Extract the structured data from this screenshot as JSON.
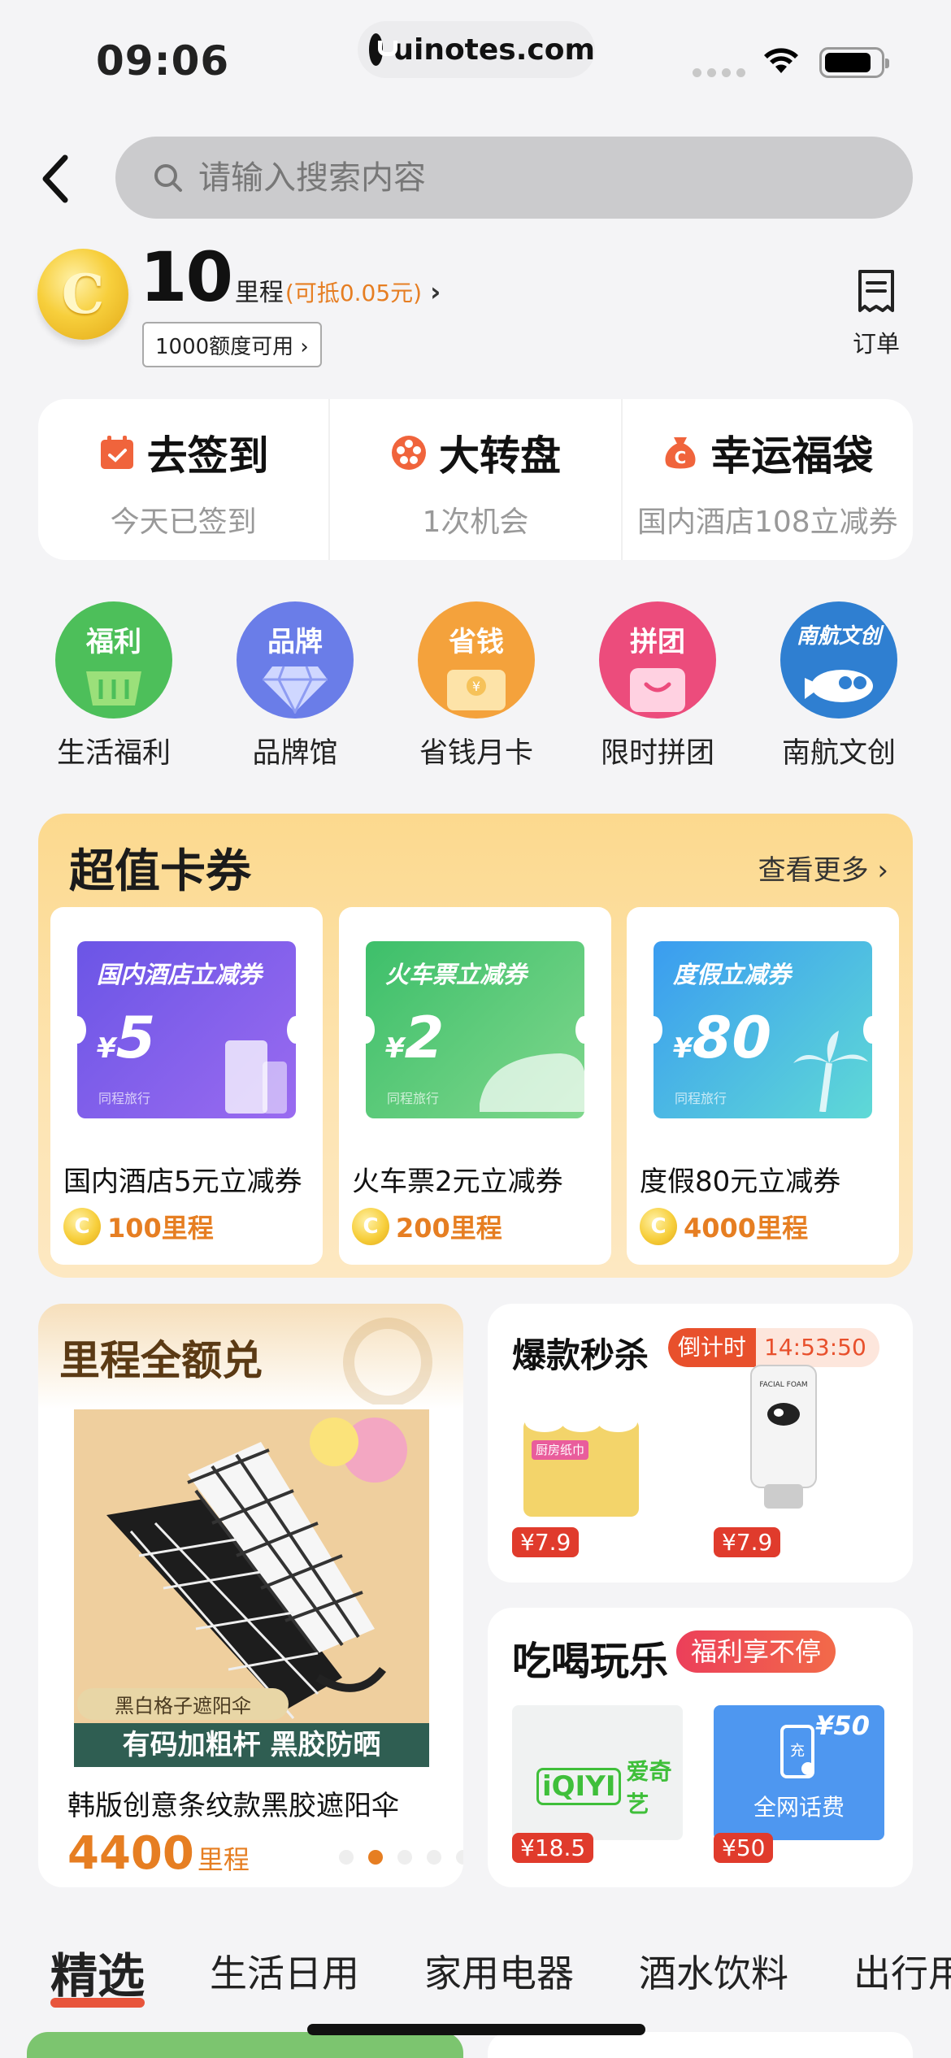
{
  "status_bar": {
    "time": "09:06",
    "url": "uinotes.com"
  },
  "search": {
    "placeholder": "请输入搜索内容"
  },
  "points": {
    "value": "10",
    "unit": "里程",
    "hint": "(可抵0.05元)",
    "quota": "1000额度可用 ›",
    "orders_label": "订单"
  },
  "tasks": [
    {
      "title": "去签到",
      "sub": "今天已签到",
      "icon": "calendar-icon"
    },
    {
      "title": "大转盘",
      "sub": "1次机会",
      "icon": "wheel-icon"
    },
    {
      "title": "幸运福袋",
      "sub": "国内酒店108立减券",
      "icon": "lucky-bag-icon"
    }
  ],
  "categories": [
    {
      "tag": "福利",
      "label": "生活福利",
      "color": "#4dbf5a"
    },
    {
      "tag": "品牌",
      "label": "品牌馆",
      "color": "#6a7de8"
    },
    {
      "tag": "省钱",
      "label": "省钱月卡",
      "color": "#f4a23c"
    },
    {
      "tag": "拼团",
      "label": "限时拼团",
      "color": "#ec4c7c"
    },
    {
      "tag": "南航文创",
      "label": "南航文创",
      "color": "#2f7fd1"
    }
  ],
  "coupons": {
    "title": "超值卡券",
    "more": "查看更多 ›",
    "items": [
      {
        "ticket_title": "国内酒店立减券",
        "currency": "¥",
        "amount": "5",
        "brand": "同程旅行",
        "name": "国内酒店5元立减券",
        "price": "100里程",
        "colors": [
          "#6b55e6",
          "#9a6bf0"
        ]
      },
      {
        "ticket_title": "火车票立减券",
        "currency": "¥",
        "amount": "2",
        "brand": "同程旅行",
        "name": "火车票2元立减券",
        "price": "200里程",
        "colors": [
          "#3dbf6a",
          "#7fd78c"
        ]
      },
      {
        "ticket_title": "度假立减券",
        "currency": "¥",
        "amount": "80",
        "brand": "同程旅行",
        "name": "度假80元立减券",
        "price": "4000里程",
        "colors": [
          "#3a9cf0",
          "#5fd9d6"
        ]
      }
    ]
  },
  "mileage": {
    "title": "里程全额兑",
    "tag": "黑白格子遮阳伞",
    "caption": "有码加粗杆 黑胶防晒",
    "name": "韩版创意条纹款黑胶遮阳伞",
    "price": "4400",
    "unit": "里程",
    "active_dot": 2
  },
  "flash": {
    "title": "爆款秒杀",
    "timer_label": "倒计时",
    "countdown": "14:53:50",
    "items": [
      {
        "label": "厨房纸巾",
        "price": "¥7.9"
      },
      {
        "label": "FACIAL FOAM",
        "price": "¥7.9"
      }
    ]
  },
  "fun": {
    "title": "吃喝玩乐",
    "tag": "福利享不停",
    "items": [
      {
        "label": "爱奇艺",
        "logo": "iQIYI",
        "price": "¥18.5"
      },
      {
        "label": "全网话费",
        "badge": "¥50",
        "charge": "充",
        "price": "¥50"
      }
    ]
  },
  "tabs": [
    "精选",
    "生活日用",
    "家用电器",
    "酒水饮料",
    "出行用品"
  ]
}
